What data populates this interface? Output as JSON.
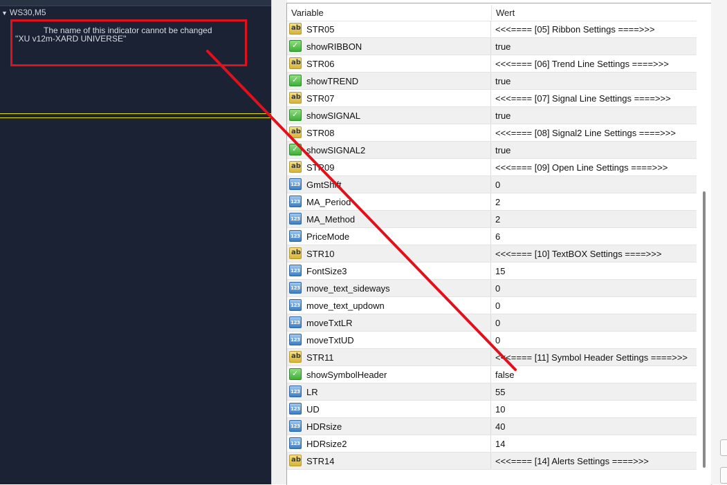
{
  "chart": {
    "symbol_label": "WS30,M5",
    "indicator_message_line1": "The name of this indicator cannot be changed",
    "indicator_message_line2": "''XU v12m-XARD UNIVERSE''"
  },
  "grid": {
    "header_variable": "Variable",
    "header_value": "Wert",
    "rows": [
      {
        "type": "string",
        "name": "STR05",
        "value": "<<<==== [05] Ribbon Settings ====>>>"
      },
      {
        "type": "bool",
        "name": "showRIBBON",
        "value": "true"
      },
      {
        "type": "string",
        "name": "STR06",
        "value": "<<<==== [06] Trend Line Settings ====>>>"
      },
      {
        "type": "bool",
        "name": "showTREND",
        "value": "true"
      },
      {
        "type": "string",
        "name": "STR07",
        "value": "<<<==== [07] Signal Line Settings ====>>>"
      },
      {
        "type": "bool",
        "name": "showSIGNAL",
        "value": "true"
      },
      {
        "type": "string",
        "name": "STR08",
        "value": "<<<==== [08] Signal2 Line Settings ====>>>"
      },
      {
        "type": "bool",
        "name": "showSIGNAL2",
        "value": "true"
      },
      {
        "type": "string",
        "name": "STR09",
        "value": "<<<==== [09] Open Line Settings ====>>>"
      },
      {
        "type": "number",
        "name": "GmtShift",
        "value": "0"
      },
      {
        "type": "number",
        "name": "MA_Period",
        "value": "2"
      },
      {
        "type": "number",
        "name": "MA_Method",
        "value": "2"
      },
      {
        "type": "number",
        "name": "PriceMode",
        "value": "6"
      },
      {
        "type": "string",
        "name": "STR10",
        "value": "<<<==== [10] TextBOX Settings ====>>>"
      },
      {
        "type": "number",
        "name": "FontSize3",
        "value": "15"
      },
      {
        "type": "number",
        "name": "move_text_sideways",
        "value": "0"
      },
      {
        "type": "number",
        "name": "move_text_updown",
        "value": "0"
      },
      {
        "type": "number",
        "name": "moveTxtLR",
        "value": "0"
      },
      {
        "type": "number",
        "name": "moveTxtUD",
        "value": "0"
      },
      {
        "type": "string",
        "name": "STR11",
        "value": "<<<==== [11] Symbol Header Settings ====>>>"
      },
      {
        "type": "bool",
        "name": "showSymbolHeader",
        "value": "false"
      },
      {
        "type": "number",
        "name": "LR",
        "value": "55"
      },
      {
        "type": "number",
        "name": "UD",
        "value": "10"
      },
      {
        "type": "number",
        "name": "HDRsize",
        "value": "40"
      },
      {
        "type": "number",
        "name": "HDRsize2",
        "value": "14"
      },
      {
        "type": "string",
        "name": "STR14",
        "value": "<<<==== [14] Alerts Settings ====>>>"
      }
    ]
  },
  "icons": {
    "string": {
      "glyph": "ab",
      "name": "string-type-icon"
    },
    "bool": {
      "glyph": "✓",
      "name": "boolean-type-icon"
    },
    "number": {
      "glyph": "123",
      "name": "number-type-icon"
    }
  },
  "colors": {
    "chart_background": "#1a2234",
    "annotation_red": "#e0111c",
    "level_line_yellow": "#e6e21a"
  }
}
